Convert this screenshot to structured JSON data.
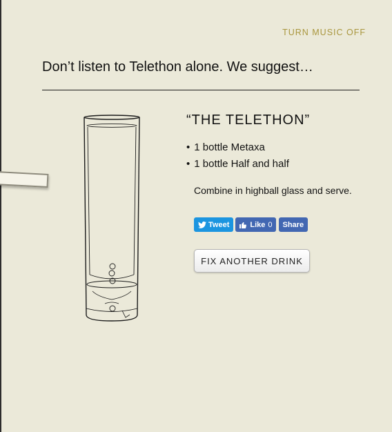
{
  "header": {
    "music_toggle": "TURN MUSIC OFF"
  },
  "headline": "Don’t listen to Telethon alone. We suggest…",
  "drink": {
    "name": "“THE TELETHON”",
    "ingredients": [
      "1 bottle Metaxa",
      "1 bottle Half and half"
    ],
    "instructions": "Combine in highball glass and serve."
  },
  "social": {
    "tweet_label": "Tweet",
    "like_label": "Like",
    "like_count": "0",
    "share_label": "Share",
    "colors": {
      "twitter": "#1b95e0",
      "facebook": "#4267b2"
    },
    "icons": [
      "twitter-bird-icon",
      "thumbs-up-icon"
    ]
  },
  "actions": {
    "fix_another": "FIX ANOTHER DRINK"
  },
  "colors": {
    "background": "#ebe9d9",
    "accent": "#a9963d",
    "text": "#111111"
  }
}
